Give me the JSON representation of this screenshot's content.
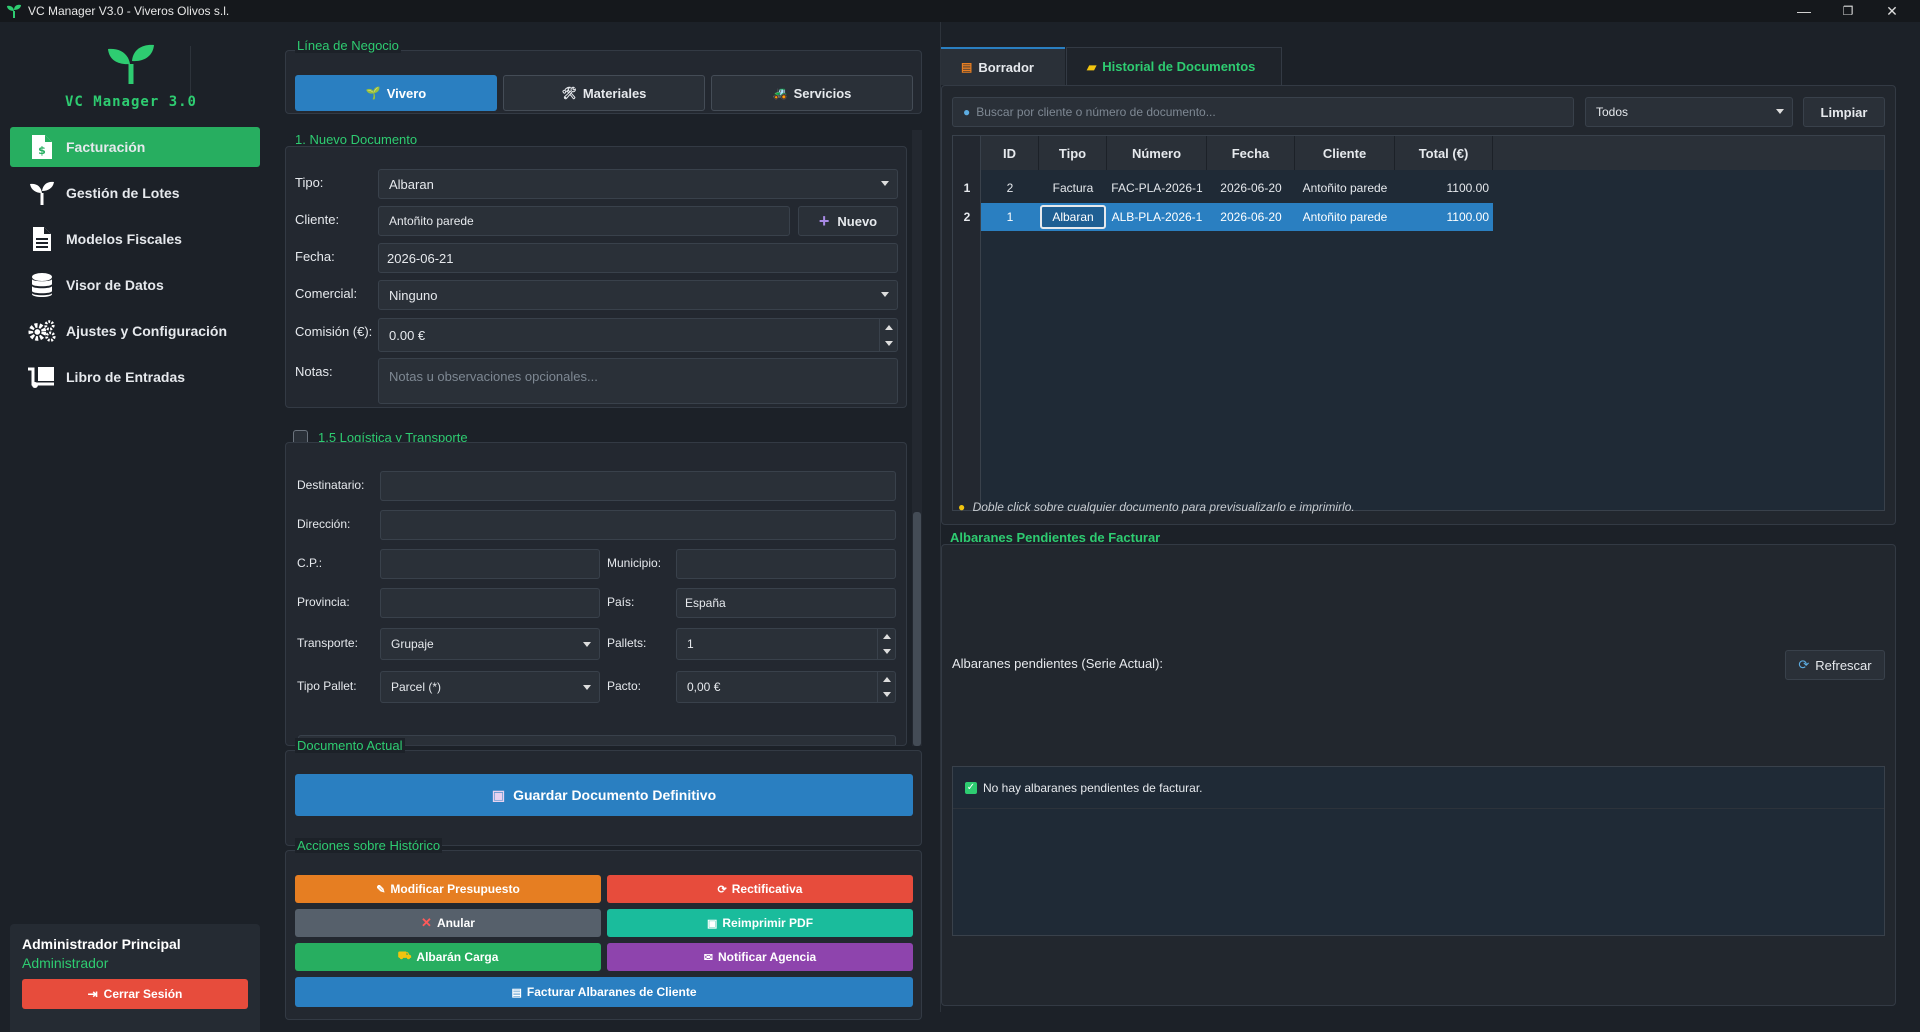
{
  "window": {
    "title": "VC Manager V3.0 - Viveros Olivos s.l.",
    "minimize": "—",
    "maximize": "❐",
    "close": "✕"
  },
  "sidebar": {
    "logo_text": "VC Manager 3.0",
    "items": [
      {
        "label": "Facturación",
        "icon": "invoice-icon",
        "active": true
      },
      {
        "label": "Gestión de Lotes",
        "icon": "sprout-icon",
        "active": false
      },
      {
        "label": "Modelos Fiscales",
        "icon": "document-icon",
        "active": false
      },
      {
        "label": "Visor de Datos",
        "icon": "database-icon",
        "active": false
      },
      {
        "label": "Ajustes y Configuración",
        "icon": "gears-icon",
        "active": false
      },
      {
        "label": "Libro de Entradas",
        "icon": "dolly-icon",
        "active": false
      }
    ],
    "user": {
      "name": "Administrador Principal",
      "role": "Administrador",
      "logout_label": "Cerrar Sesión"
    }
  },
  "business_line": {
    "title": "Línea de Negocio",
    "options": [
      {
        "label": "Vivero",
        "icon": "🌱",
        "active": true
      },
      {
        "label": "Materiales",
        "icon": "🛠",
        "active": false
      },
      {
        "label": "Servicios",
        "icon": "🚜",
        "active": false
      }
    ]
  },
  "new_document": {
    "title": "1. Nuevo Documento",
    "tipo_label": "Tipo:",
    "tipo_value": "Albaran",
    "cliente_label": "Cliente:",
    "cliente_value": "Antoñito parede",
    "nuevo_label": "Nuevo",
    "fecha_label": "Fecha:",
    "fecha_value": "2026-06-21",
    "comercial_label": "Comercial:",
    "comercial_value": "Ninguno",
    "comision_label": "Comisión (€):",
    "comision_value": "0.00 €",
    "notas_label": "Notas:",
    "notas_placeholder": "Notas u observaciones opcionales..."
  },
  "logistics": {
    "title": "1.5 Logística y Transporte",
    "destinatario_label": "Destinatario:",
    "direccion_label": "Dirección:",
    "cp_label": "C.P.:",
    "municipio_label": "Municipio:",
    "provincia_label": "Provincia:",
    "pais_label": "País:",
    "pais_value": "España",
    "transporte_label": "Transporte:",
    "transporte_value": "Grupaje",
    "pallets_label": "Pallets:",
    "pallets_value": "1",
    "tipo_pallet_label": "Tipo Pallet:",
    "tipo_pallet_value": "Parcel (*)",
    "pacto_label": "Pacto:",
    "pacto_value": "0,00 €"
  },
  "current_document": {
    "title": "Documento Actual",
    "save_label": "Guardar Documento Definitivo"
  },
  "history_actions": {
    "title": "Acciones sobre Histórico",
    "buttons": [
      {
        "label": "Modificar Presupuesto",
        "icon": "✎",
        "color": "#e67e22"
      },
      {
        "label": "Rectificativa",
        "icon": "⟳",
        "color": "#e74c3c"
      },
      {
        "label": "Anular",
        "icon": "✕",
        "color": "#56606b"
      },
      {
        "label": "Reimprimir PDF",
        "icon": "▣",
        "color": "#1abc9c"
      },
      {
        "label": "Albarán Carga",
        "icon": "⛟",
        "color": "#27ae60"
      },
      {
        "label": "Notificar Agencia",
        "icon": "✉",
        "color": "#8e44ad"
      },
      {
        "label": "Facturar Albaranes de Cliente",
        "icon": "▤",
        "color": "#2a7fc1"
      }
    ]
  },
  "tabs": [
    {
      "label": "Borrador",
      "icon": "📄",
      "active": true
    },
    {
      "label": "Historial de Documentos",
      "icon": "📁",
      "active": false
    }
  ],
  "search": {
    "placeholder": "Buscar por cliente o número de documento...",
    "filter_value": "Todos",
    "clear_label": "Limpiar"
  },
  "table": {
    "columns": [
      "ID",
      "Tipo",
      "Número",
      "Fecha",
      "Cliente",
      "Total (€)"
    ],
    "rows": [
      {
        "index": "1",
        "id": "2",
        "tipo": "Factura",
        "numero": "FAC-PLA-2026-1",
        "fecha": "2026-06-20",
        "cliente": "Antoñito parede",
        "total": "1100.00",
        "selected": false
      },
      {
        "index": "2",
        "id": "1",
        "tipo": "Albaran",
        "numero": "ALB-PLA-2026-1",
        "fecha": "2026-06-20",
        "cliente": "Antoñito parede",
        "total": "1100.00",
        "selected": true
      }
    ],
    "hint": "Doble click sobre cualquier documento para previsualizarlo e imprimirlo."
  },
  "pending": {
    "title": "Albaranes Pendientes de Facturar",
    "label": "Albaranes pendientes (Serie Actual):",
    "refresh_label": "Refrescar",
    "empty_message": "No hay albaranes pendientes de facturar."
  },
  "colors": {
    "accent_green": "#2ecc71",
    "accent_blue": "#2a7fc1",
    "background": "#1c2128"
  }
}
